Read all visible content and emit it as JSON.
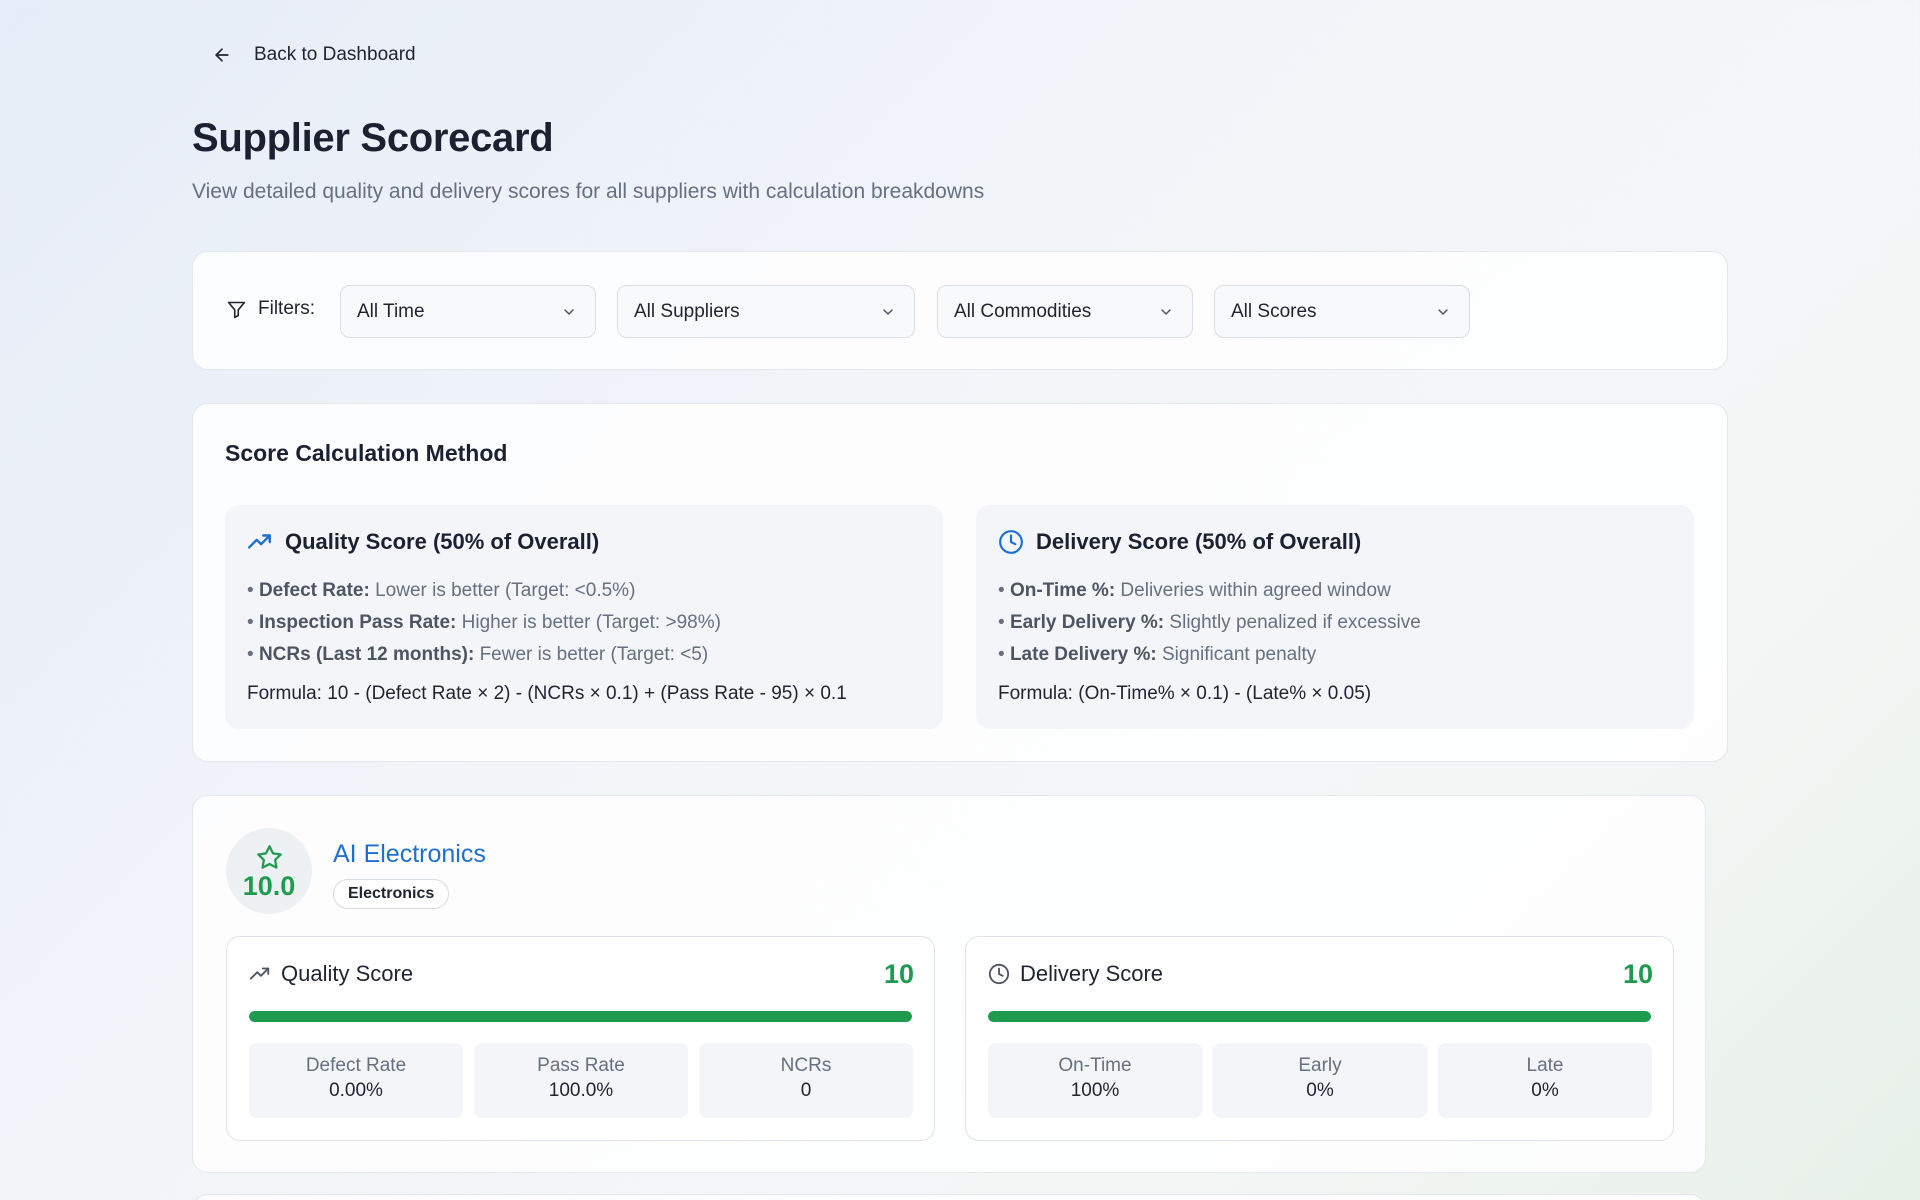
{
  "nav": {
    "back_label": "Back to Dashboard"
  },
  "header": {
    "title": "Supplier Scorecard",
    "subtitle": "View detailed quality and delivery scores for all suppliers with calculation breakdowns"
  },
  "filters": {
    "label": "Filters:",
    "time": "All Time",
    "suppliers": "All Suppliers",
    "commodities": "All Commodities",
    "scores": "All Scores"
  },
  "method": {
    "title": "Score Calculation Method",
    "quality": {
      "heading": "Quality Score (50% of Overall)",
      "bullets": [
        {
          "term": "Defect Rate:",
          "text": " Lower is better (Target: <0.5%)"
        },
        {
          "term": "Inspection Pass Rate:",
          "text": " Higher is better (Target: >98%)"
        },
        {
          "term": "NCRs (Last 12 months):",
          "text": " Fewer is better (Target: <5)"
        }
      ],
      "formula": "Formula: 10 - (Defect Rate × 2) - (NCRs × 0.1) + (Pass Rate - 95) × 0.1"
    },
    "delivery": {
      "heading": "Delivery Score (50% of Overall)",
      "bullets": [
        {
          "term": "On-Time %:",
          "text": " Deliveries within agreed window"
        },
        {
          "term": "Early Delivery %:",
          "text": " Slightly penalized if excessive"
        },
        {
          "term": "Late Delivery %:",
          "text": " Significant penalty"
        }
      ],
      "formula": "Formula: (On-Time% × 0.1) - (Late% × 0.05)"
    }
  },
  "supplier": {
    "overall_score": "10.0",
    "name": "AI Electronics",
    "commodity": "Electronics",
    "quality": {
      "label": "Quality Score",
      "score": "10",
      "progress": 1.0,
      "metrics": [
        {
          "label": "Defect Rate",
          "value": "0.00%"
        },
        {
          "label": "Pass Rate",
          "value": "100.0%"
        },
        {
          "label": "NCRs",
          "value": "0"
        }
      ]
    },
    "delivery": {
      "label": "Delivery Score",
      "score": "10",
      "progress": 1.0,
      "metrics": [
        {
          "label": "On-Time",
          "value": "100%"
        },
        {
          "label": "Early",
          "value": "0%"
        },
        {
          "label": "Late",
          "value": "0%"
        }
      ]
    }
  },
  "colors": {
    "accent_blue": "#1d6fd1",
    "score_green": "#1f9b4f",
    "muted_text": "#66707f"
  },
  "icons": {
    "back": "arrow-left-icon",
    "filter": "filter-icon",
    "chevron": "chevron-down-icon",
    "quality": "trending-up-icon",
    "delivery": "clock-icon",
    "rating": "star-icon"
  }
}
